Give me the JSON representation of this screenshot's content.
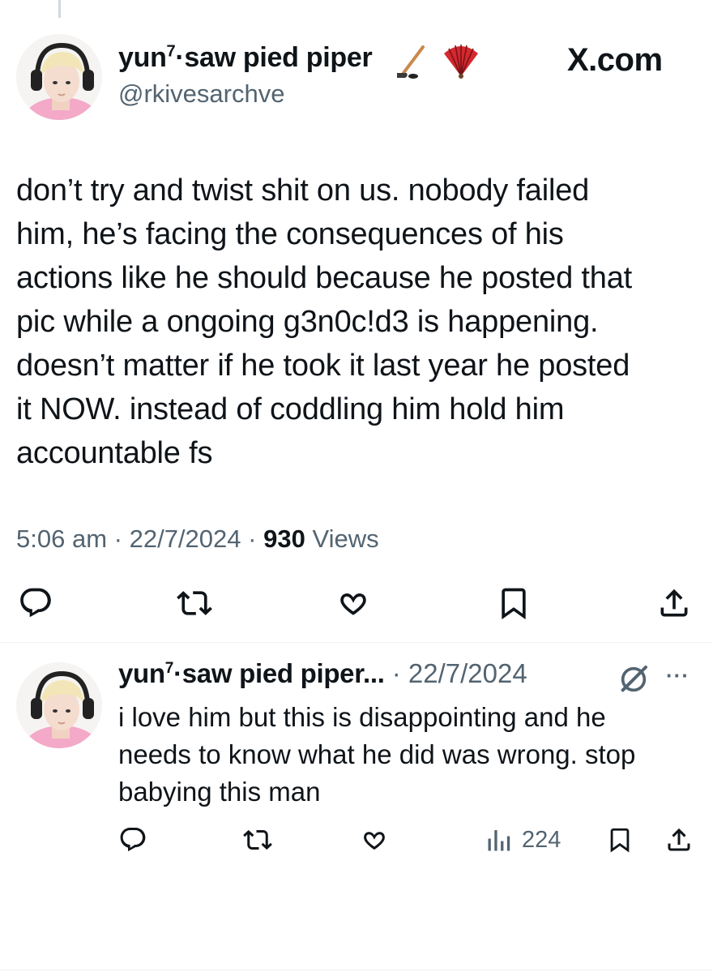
{
  "tweet": {
    "display_name": "yun",
    "display_name_sup": "7",
    "display_name_rest": "·saw pied piper",
    "handle": "@rkivesarchve",
    "source": "X.com",
    "text": "don’t try and twist shit on us. nobody failed\nhim, he’s facing the consequences of his\nactions like he should because he posted that\npic while a ongoing g3n0c!d3 is happening.\ndoesn’t matter if he took it last year he posted\nit NOW. instead of coddling him hold him\naccountable fs",
    "time": "5:06 am",
    "date": "22/7/2024",
    "separator": "·",
    "views_count": "930",
    "views_label": "Views",
    "emoji": [
      "hockey-stick-emoji",
      "folding-fan-emoji"
    ],
    "actions": [
      "reply",
      "retweet",
      "like",
      "bookmark",
      "share"
    ]
  },
  "reply": {
    "display_name": "yun",
    "display_name_sup": "7",
    "display_name_rest": "·saw pied piper...",
    "date_prefix": " · ",
    "date": "22/7/2024",
    "text": "i love him but this is disappointing and he\nneeds to know what he did was wrong. stop\nbabying this man",
    "views_count": "224",
    "more_label": "···",
    "actions": [
      "reply",
      "retweet",
      "like",
      "views",
      "bookmark",
      "share"
    ]
  },
  "colors": {
    "text": "#0f1419",
    "secondary": "#536471",
    "divider": "#eff3f4",
    "avatar_hair": "#f2e6b8",
    "avatar_pink": "#f4a9c8"
  }
}
